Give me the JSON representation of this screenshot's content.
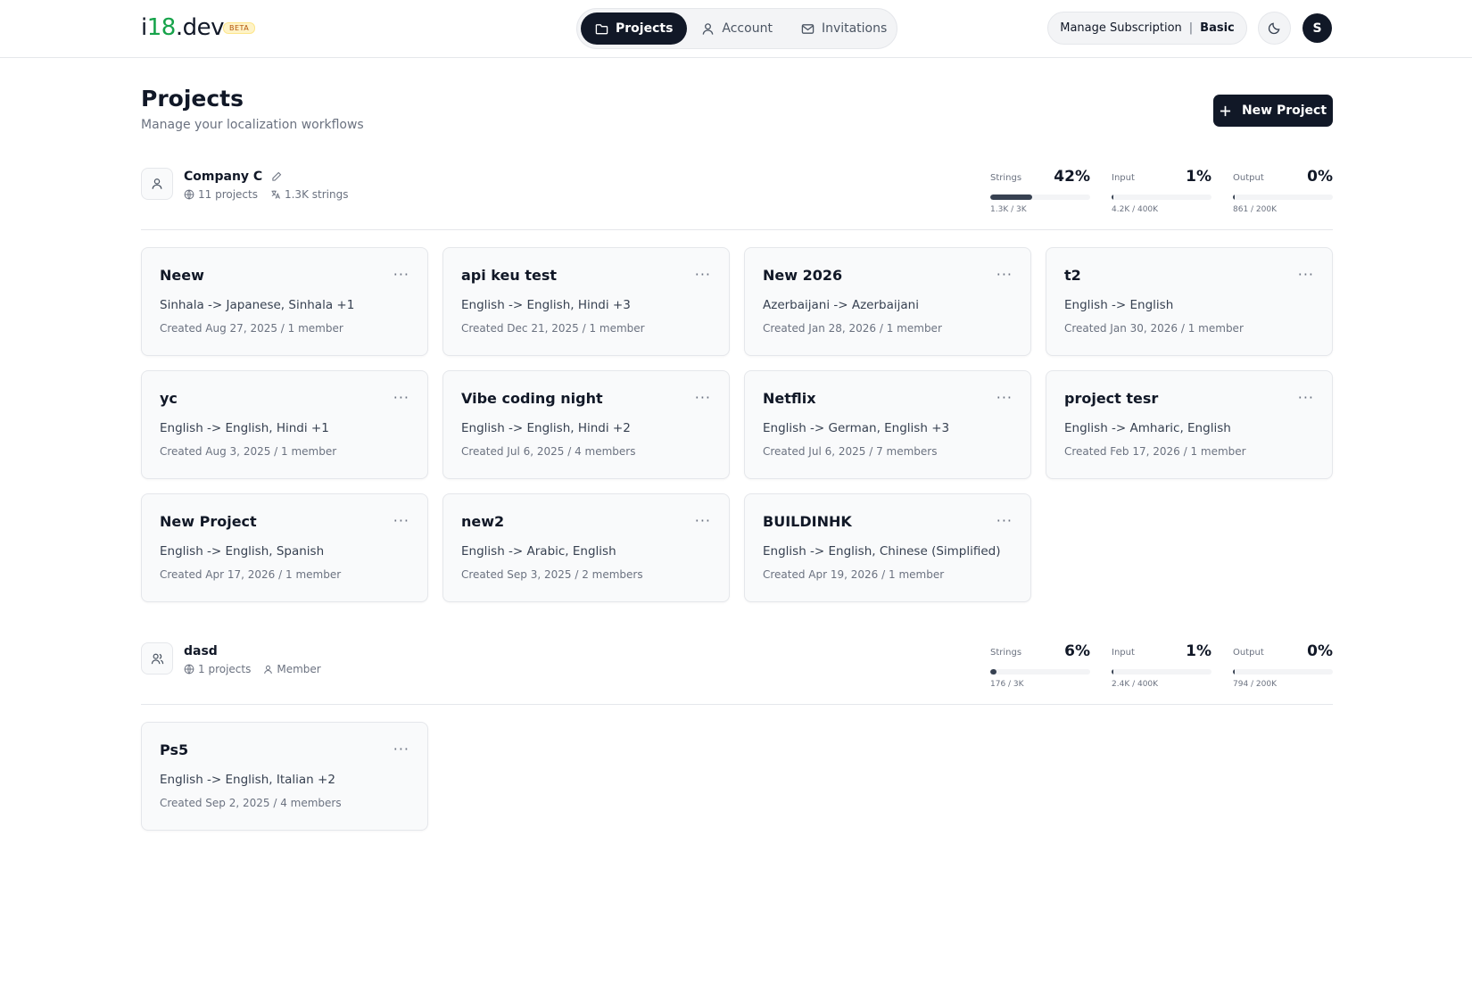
{
  "app": {
    "logo_prefix": "i",
    "logo_accent": "18",
    "logo_suffix": ".dev",
    "beta": "BETA"
  },
  "nav": {
    "items": [
      {
        "label": "Projects",
        "icon": "folder-icon",
        "active": true
      },
      {
        "label": "Account",
        "icon": "user-icon",
        "active": false
      },
      {
        "label": "Invitations",
        "icon": "mail-icon",
        "active": false
      }
    ]
  },
  "header": {
    "manage_label": "Manage Subscription",
    "separator": "|",
    "plan": "Basic",
    "avatar_initial": "S"
  },
  "page": {
    "title": "Projects",
    "subtitle": "Manage your localization workflows",
    "new_project": "New Project"
  },
  "orgs": [
    {
      "name": "Company C",
      "meta": [
        {
          "icon": "globe-icon",
          "text": "11 projects"
        },
        {
          "icon": "translate-icon",
          "text": "1.3K strings"
        }
      ],
      "metrics": [
        {
          "label": "Strings",
          "percent": "42%",
          "fraction": 0.42,
          "sub": "1.3K / 3K"
        },
        {
          "label": "Input",
          "percent": "1%",
          "fraction": 0.01,
          "sub": "4.2K / 400K"
        },
        {
          "label": "Output",
          "percent": "0%",
          "fraction": 0.0,
          "sub": "861 / 200K"
        }
      ],
      "projects": [
        {
          "name": "Neew",
          "langs": "Sinhala -> Japanese, Sinhala +1",
          "meta": "Created Aug 27, 2025 / 1 member"
        },
        {
          "name": "api keu test",
          "langs": "English -> English, Hindi +3",
          "meta": "Created Dec 21, 2025 / 1 member"
        },
        {
          "name": "New 2026",
          "langs": "Azerbaijani -> Azerbaijani",
          "meta": "Created Jan 28, 2026 / 1 member"
        },
        {
          "name": "t2",
          "langs": "English -> English",
          "meta": "Created Jan 30, 2026 / 1 member"
        },
        {
          "name": "yc",
          "langs": "English -> English, Hindi +1",
          "meta": "Created Aug 3, 2025 / 1 member"
        },
        {
          "name": "Vibe coding night",
          "langs": "English -> English, Hindi +2",
          "meta": "Created Jul 6, 2025 / 4 members"
        },
        {
          "name": "Netflix",
          "langs": "English -> German, English +3",
          "meta": "Created Jul 6, 2025 / 7 members"
        },
        {
          "name": "project tesr",
          "langs": "English -> Amharic, English",
          "meta": "Created Feb 17, 2026 / 1 member"
        },
        {
          "name": "New Project",
          "langs": "English -> English, Spanish",
          "meta": "Created Apr 17, 2026 / 1 member"
        },
        {
          "name": "new2",
          "langs": "English -> Arabic, English",
          "meta": "Created Sep 3, 2025 / 2 members"
        },
        {
          "name": "BUILDINHK",
          "langs": "English -> English, Chinese (Simplified)",
          "meta": "Created Apr 19, 2026 / 1 member"
        }
      ]
    },
    {
      "name": "dasd",
      "meta": [
        {
          "icon": "globe-icon",
          "text": "1 projects"
        },
        {
          "icon": "user-icon",
          "text": "Member"
        }
      ],
      "metrics": [
        {
          "label": "Strings",
          "percent": "6%",
          "fraction": 0.06,
          "sub": "176 / 3K"
        },
        {
          "label": "Input",
          "percent": "1%",
          "fraction": 0.01,
          "sub": "2.4K / 400K"
        },
        {
          "label": "Output",
          "percent": "0%",
          "fraction": 0.0,
          "sub": "794 / 200K"
        }
      ],
      "projects": [
        {
          "name": "Ps5",
          "langs": "English -> English, Italian +2",
          "meta": "Created Sep 2, 2025 / 4 members"
        }
      ]
    }
  ],
  "menu_glyph": "···"
}
